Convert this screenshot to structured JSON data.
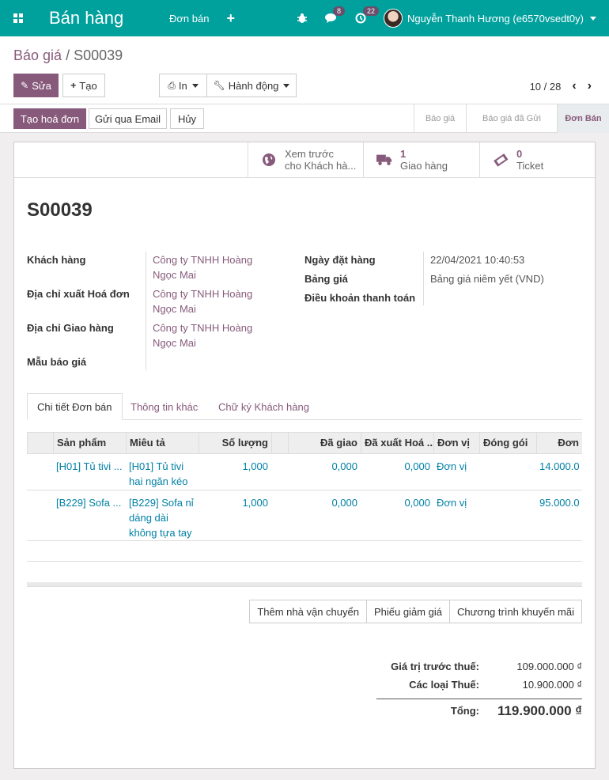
{
  "navbar": {
    "brand": "Bán hàng",
    "menu_orders": "Đơn bán",
    "plus": "+",
    "messages_count": "8",
    "activities_count": "22",
    "user_name": "Nguyễn Thanh Hương (e6570vsedt0y)"
  },
  "breadcrumb": {
    "parent": "Báo giá",
    "separator": "/",
    "current": "S00039"
  },
  "toolbar": {
    "edit": "Sửa",
    "create": "Tạo",
    "print": "In",
    "action": "Hành động",
    "pager": "10 / 28"
  },
  "statusbar": {
    "create_invoice": "Tạo hoá đơn",
    "send_email": "Gửi qua Email",
    "cancel": "Hủy",
    "stages": [
      "Báo giá",
      "Báo giá đã Gửi",
      "Đơn Bán"
    ],
    "active_stage": "Đơn Bán"
  },
  "smart_buttons": [
    {
      "line1": "Xem trước",
      "line2": "cho Khách hà...",
      "icon": "globe-icon"
    },
    {
      "line1": "1",
      "line2": "Giao hàng",
      "icon": "truck-icon"
    },
    {
      "line1": "0",
      "line2": "Ticket",
      "icon": "ticket-icon"
    }
  ],
  "order": {
    "name": "S00039",
    "customer_label": "Khách hàng",
    "customer": [
      "Công ty TNHH Hoàng",
      "Ngọc Mai"
    ],
    "invoice_addr_label": "Địa chỉ xuất Hoá đơn",
    "invoice_addr": [
      "Công ty TNHH Hoàng",
      "Ngọc Mai"
    ],
    "delivery_addr_label": "Địa chỉ Giao hàng",
    "delivery_addr": [
      "Công ty TNHH Hoàng",
      "Ngọc Mai"
    ],
    "template_label": "Mẫu báo giá",
    "date_label": "Ngày đặt hàng",
    "date": "22/04/2021 10:40:53",
    "pricelist_label": "Bảng giá",
    "pricelist": "Bảng giá niêm yết (VND)",
    "payment_terms_label": "Điều khoản thanh toán"
  },
  "tabs": [
    "Chi tiết Đơn bán",
    "Thông tin khác",
    "Chữ ký Khách hàng"
  ],
  "table": {
    "headers": [
      "Sản phẩm",
      "Miêu tả",
      "Số lượng",
      "Đã giao",
      "Đã xuất Hoá ...",
      "Đơn vị",
      "Đóng gói",
      "Đơn"
    ],
    "rows": [
      {
        "product": "[H01] Tủ tivi ...",
        "desc": [
          "[H01] Tủ tivi",
          "hai ngăn kéo"
        ],
        "qty": "1,000",
        "delivered": "0,000",
        "invoiced": "0,000",
        "uom": "Đơn vị",
        "price": "14.000.0"
      },
      {
        "product": "[B229] Sofa ...",
        "desc": [
          "[B229] Sofa nỉ",
          "dáng dài",
          "không tựa tay"
        ],
        "qty": "1,000",
        "delivered": "0,000",
        "invoiced": "0,000",
        "uom": "Đơn vị",
        "price": "95.000.0"
      }
    ]
  },
  "footer_buttons": [
    "Thêm nhà vận chuyển",
    "Phiếu giảm giá",
    "Chương trình khuyến mãi"
  ],
  "totals": {
    "untaxed_label": "Giá trị trước thuế:",
    "untaxed": "109.000.000 ₫",
    "taxes_label": "Các loại Thuế:",
    "taxes": "10.900.000 ₫",
    "total_label": "Tổng:",
    "total": "119.900.000 ₫"
  }
}
